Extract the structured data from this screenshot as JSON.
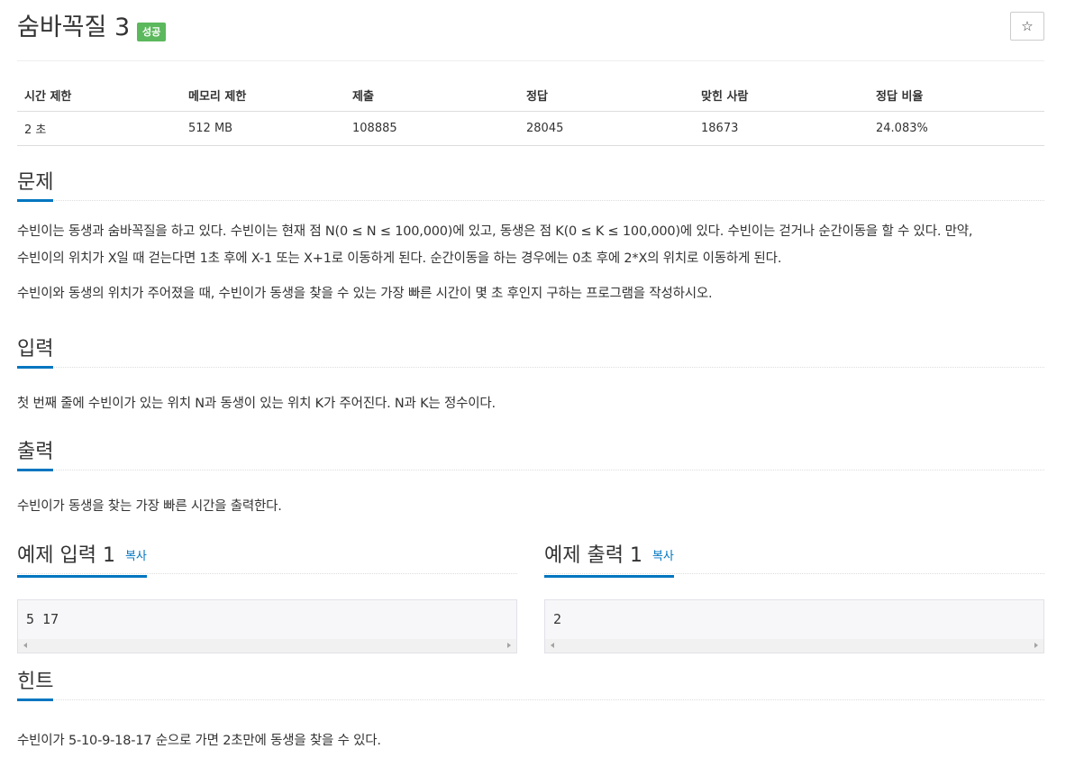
{
  "header": {
    "title": "숨바꼭질 3",
    "badge": "성공",
    "star_icon": "☆"
  },
  "info": {
    "columns": [
      "시간 제한",
      "메모리 제한",
      "제출",
      "정답",
      "맞힌 사람",
      "정답 비율"
    ],
    "values": [
      "2 초",
      "512 MB",
      "108885",
      "28045",
      "18673",
      "24.083%"
    ]
  },
  "problem": {
    "title": "문제",
    "paragraph1_line1": "수빈이는 동생과 숨바꼭질을 하고 있다. 수빈이는 현재 점 N(0 ≤ N ≤ 100,000)에 있고, 동생은 점 K(0 ≤ K ≤ 100,000)에 있다. 수빈이는 걷거나 순간이동을 할 수 있다. 만약,",
    "paragraph1_line2": "수빈이의 위치가 X일 때 걷는다면 1초 후에 X-1 또는 X+1로 이동하게 된다. 순간이동을 하는 경우에는 0초 후에 2*X의 위치로 이동하게 된다.",
    "paragraph2": "수빈이와 동생의 위치가 주어졌을 때, 수빈이가 동생을 찾을 수 있는 가장 빠른 시간이 몇 초 후인지 구하는 프로그램을 작성하시오."
  },
  "input": {
    "title": "입력",
    "text": "첫 번째 줄에 수빈이가 있는 위치 N과 동생이 있는 위치 K가 주어진다. N과 K는 정수이다."
  },
  "output": {
    "title": "출력",
    "text": "수빈이가 동생을 찾는 가장 빠른 시간을 출력한다."
  },
  "sample_input": {
    "title": "예제 입력 1",
    "copy": "복사",
    "content": "5 17"
  },
  "sample_output": {
    "title": "예제 출력 1",
    "copy": "복사",
    "content": "2"
  },
  "hint": {
    "title": "힌트",
    "text": "수빈이가 5-10-9-18-17 순으로 가면 2초만에 동생을 찾을 수 있다."
  }
}
